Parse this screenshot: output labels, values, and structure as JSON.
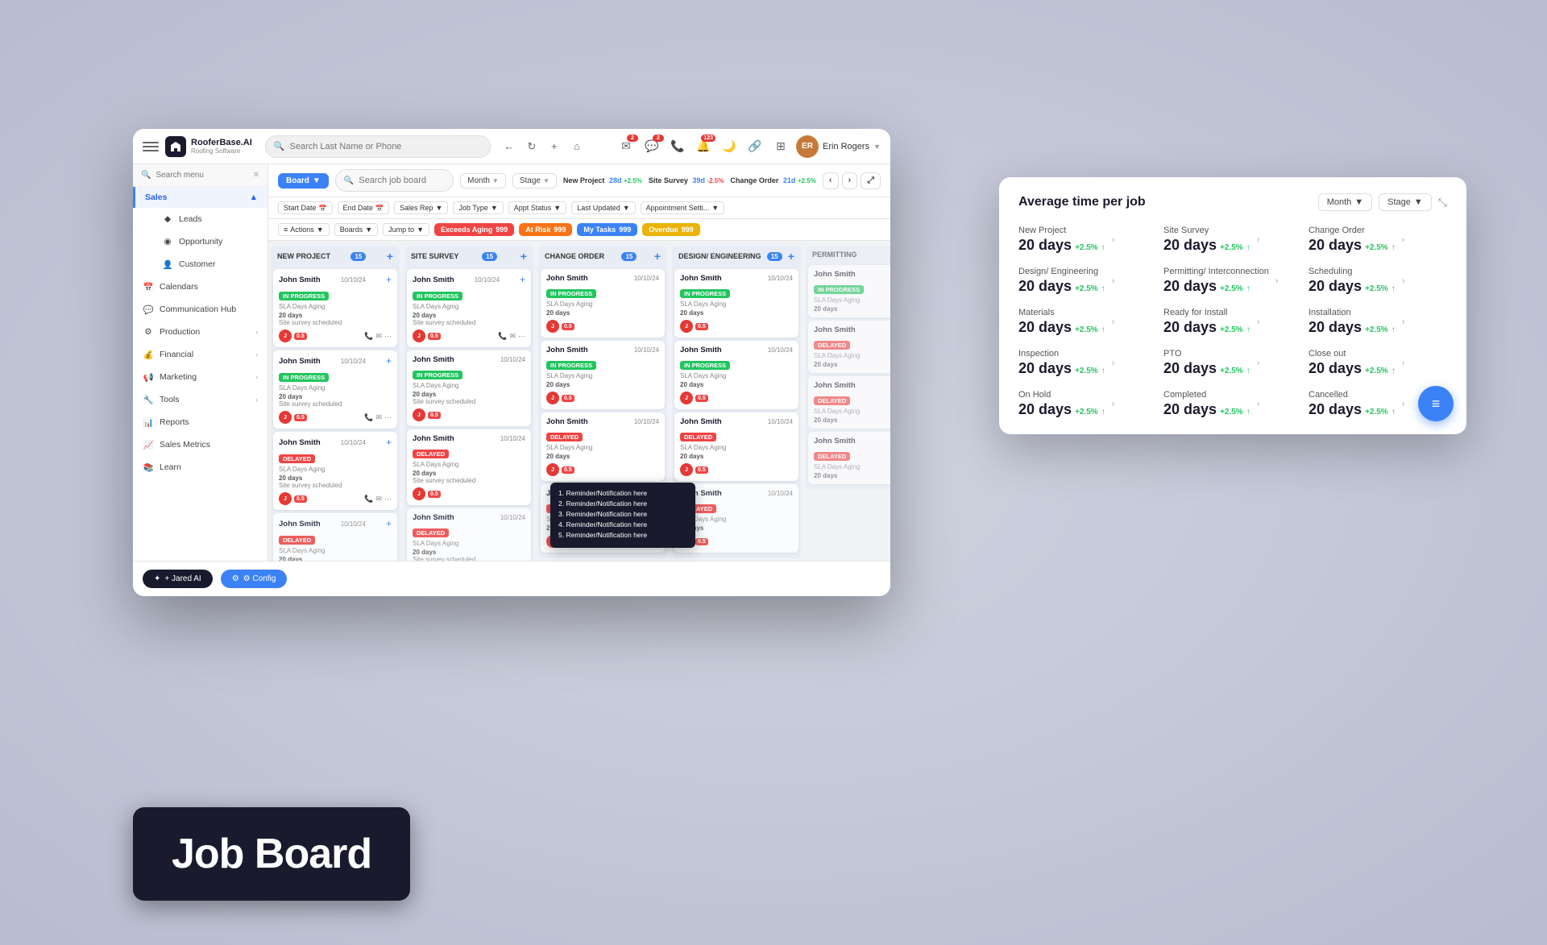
{
  "app": {
    "name": "RooferBase.AI",
    "tagline": "Roofing Software"
  },
  "topbar": {
    "search_placeholder": "Search Last Name or Phone",
    "user_name": "Erin Rogers",
    "badges": {
      "messages": "2",
      "chat": "2",
      "notifications": "123"
    }
  },
  "sidebar": {
    "search_placeholder": "Search menu",
    "items": [
      {
        "label": "Sales",
        "active": true,
        "icon": "sales-icon"
      },
      {
        "label": "Leads",
        "icon": "leads-icon",
        "sub": true
      },
      {
        "label": "Opportunity",
        "icon": "opportunity-icon",
        "sub": true
      },
      {
        "label": "Customer",
        "icon": "customer-icon",
        "sub": true
      },
      {
        "label": "Calendars",
        "icon": "calendar-icon"
      },
      {
        "label": "Communication Hub",
        "icon": "comm-icon"
      },
      {
        "label": "Production",
        "icon": "production-icon"
      },
      {
        "label": "Financial",
        "icon": "financial-icon"
      },
      {
        "label": "Marketing",
        "icon": "marketing-icon"
      },
      {
        "label": "Tools",
        "icon": "tools-icon"
      },
      {
        "label": "Reports",
        "icon": "reports-icon"
      },
      {
        "label": "Sales Metrics",
        "icon": "metrics-icon"
      },
      {
        "label": "Learn",
        "icon": "learn-icon"
      }
    ]
  },
  "board_toolbar": {
    "board_label": "Board",
    "search_placeholder": "Search job board",
    "month_label": "Month",
    "stage_label": "Stage",
    "new_project_metric": "New Project",
    "new_project_days": "28d",
    "new_project_change": "+2.5%",
    "site_survey_metric": "Site Survey",
    "site_survey_days": "39d",
    "site_survey_change": "-2.5%",
    "change_order_metric": "Change Order",
    "change_order_days": "21d",
    "change_order_change": "+2.5%"
  },
  "filters": {
    "start_date": "Start Date",
    "end_date": "End Date",
    "sales_rep": "Sales Rep",
    "job_type": "Job Type",
    "appt_status": "Appt Status",
    "last_updated": "Last Updated",
    "appointment_settings": "Appointment Setti...",
    "actions": "Actions",
    "boards": "Boards",
    "jump_to": "Jump to",
    "exceeds_aging": "Exceeds Aging",
    "exceeds_count": "999",
    "at_risk": "At Risk",
    "at_risk_count": "999",
    "my_tasks": "My Tasks",
    "my_tasks_count": "999",
    "overdue": "Overdue",
    "overdue_count": "999"
  },
  "columns": [
    {
      "title": "NEW PROJECT",
      "count": "15"
    },
    {
      "title": "SITE SURVEY",
      "count": "15"
    },
    {
      "title": "CHANGE ORDER",
      "count": "15"
    },
    {
      "title": "DESIGN/ ENGINEERING",
      "count": "15"
    }
  ],
  "cards": [
    {
      "name": "John Smith",
      "status": "IN PROGRESS",
      "status_type": "inprogress",
      "date": "10/10/24",
      "meta": "SLA Days Aging",
      "days": "20 days",
      "note": "Site survey scheduled"
    },
    {
      "name": "John Smith",
      "status": "IN PROGRESS",
      "status_type": "inprogress",
      "date": "10/10/24",
      "meta": "SLA Days Aging",
      "days": "20 days",
      "note": "Site survey scheduled"
    },
    {
      "name": "John Smith",
      "status": "DELAYED",
      "status_type": "delayed",
      "date": "10/10/24",
      "meta": "SLA Days Aging",
      "days": "20 days",
      "note": "Site survey scheduled"
    }
  ],
  "notifications": [
    "1. Reminder/Notification here",
    "2. Reminder/Notification here",
    "3. Reminder/Notification here",
    "4. Reminder/Notification here",
    "5. Reminder/Notification here"
  ],
  "avg_time_panel": {
    "title": "Average time per job",
    "month_label": "Month",
    "stage_label": "Stage",
    "metrics": [
      {
        "label": "New Project",
        "value": "20 days",
        "change": "+2.5%"
      },
      {
        "label": "Site Survey",
        "value": "20 days",
        "change": "+2.5%"
      },
      {
        "label": "Change Order",
        "value": "20 days",
        "change": "+2.5%"
      },
      {
        "label": "Design/ Engineering",
        "value": "20 days",
        "change": "+2.5%"
      },
      {
        "label": "Permitting/ Interconnection",
        "value": "20 days",
        "change": "+2.5%"
      },
      {
        "label": "Scheduling",
        "value": "20 days",
        "change": "+2.5%"
      },
      {
        "label": "Materials",
        "value": "20 days",
        "change": "+2.5%"
      },
      {
        "label": "Ready for Install",
        "value": "20 days",
        "change": "+2.5%"
      },
      {
        "label": "Installation",
        "value": "20 days",
        "change": "+2.5%"
      },
      {
        "label": "Inspection",
        "value": "20 days",
        "change": "+2.5%"
      },
      {
        "label": "PTO",
        "value": "20 days",
        "change": "+2.5%"
      },
      {
        "label": "Close out",
        "value": "20 days",
        "change": "+2.5%"
      },
      {
        "label": "On Hold",
        "value": "20 days",
        "change": "+2.5%"
      },
      {
        "label": "Completed",
        "value": "20 days",
        "change": "+2.5%"
      },
      {
        "label": "Cancelled",
        "value": "20 days",
        "change": "+2.5%"
      }
    ]
  },
  "job_board_label": "Job Board",
  "bottom_bar": {
    "jared_btn": "+ Jared AI",
    "config_btn": "⚙ Config"
  }
}
